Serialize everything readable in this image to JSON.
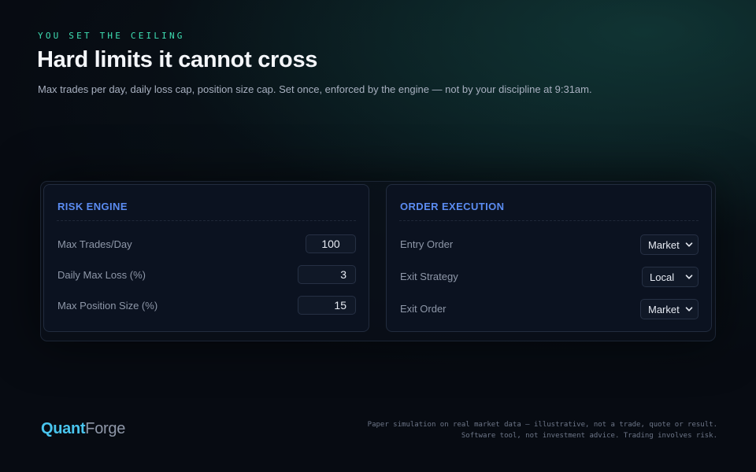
{
  "hero": {
    "eyebrow": "YOU SET THE CEILING",
    "title": "Hard limits it cannot cross",
    "subtitle": "Max trades per day, daily loss cap, position size cap. Set once, enforced by the engine — not by your discipline at 9:31am."
  },
  "risk_engine": {
    "title": "RISK ENGINE",
    "fields": [
      {
        "label": "Max Trades/Day",
        "value": "100"
      },
      {
        "label": "Daily Max Loss (%)",
        "value": "3"
      },
      {
        "label": "Max Position Size (%)",
        "value": "15"
      }
    ]
  },
  "order_execution": {
    "title": "ORDER EXECUTION",
    "fields": [
      {
        "label": "Entry Order",
        "selected": "Market",
        "icon": "chevron-down-icon"
      },
      {
        "label": "Exit Strategy",
        "selected": "Local",
        "icon": "chevron-down-icon"
      },
      {
        "label": "Exit Order",
        "selected": "Market",
        "icon": "chevron-down-icon"
      }
    ]
  },
  "brand": {
    "part_a": "Quant",
    "part_b": "Forge"
  },
  "disclaimer": {
    "line1": "Paper simulation on real market data — illustrative, not a trade, quote or result.",
    "line2": "Software tool, not investment advice. Trading involves risk."
  },
  "colors": {
    "accent_teal": "#3fe0b4",
    "accent_blue": "#5b8cf2",
    "brand_cyan": "#49c5ee",
    "background": "#070b12"
  }
}
